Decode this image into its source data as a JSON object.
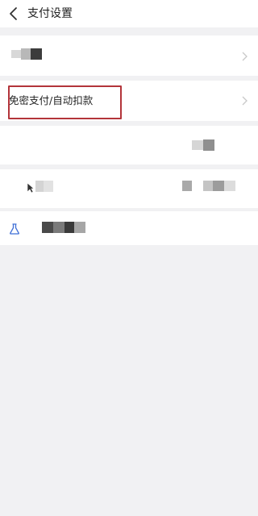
{
  "header": {
    "title": "支付设置",
    "back_icon": "back-arrow-icon"
  },
  "rows": [
    {
      "label": "",
      "icon": "chevron-right-icon",
      "obscured": true
    },
    {
      "label": "免密支付/自动扣款",
      "icon": "chevron-right-icon",
      "highlight_color": "#b3343a"
    },
    {
      "label": "",
      "obscured": true
    },
    {
      "label": "",
      "obscured": true
    },
    {
      "label": "",
      "icon": "flask-icon",
      "obscured": true
    }
  ],
  "colors": {
    "page_bg": "#f1f1f3",
    "cell_bg": "#ffffff",
    "chevron": "#c8c8c8",
    "highlight": "#b3343a"
  }
}
